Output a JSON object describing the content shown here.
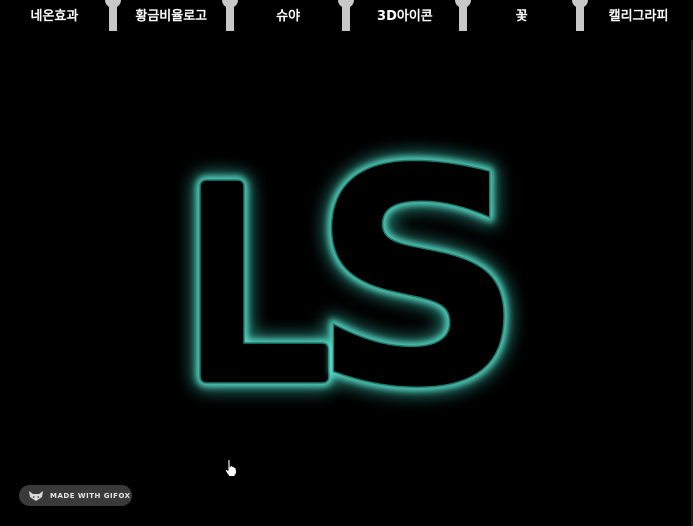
{
  "tabs": [
    {
      "label": "네온효과"
    },
    {
      "label": "황금비율로고"
    },
    {
      "label": "슈야"
    },
    {
      "label": "3D아이콘"
    },
    {
      "label": "꽃"
    },
    {
      "label": "캘리그라피"
    }
  ],
  "main": {
    "logo_text": "LS",
    "glow_color": "#3ed2bd"
  },
  "badge": {
    "text": "MADE WITH GIFOX",
    "icon": "fox-icon"
  },
  "cursor": {
    "icon": "hand-pointer-icon"
  }
}
